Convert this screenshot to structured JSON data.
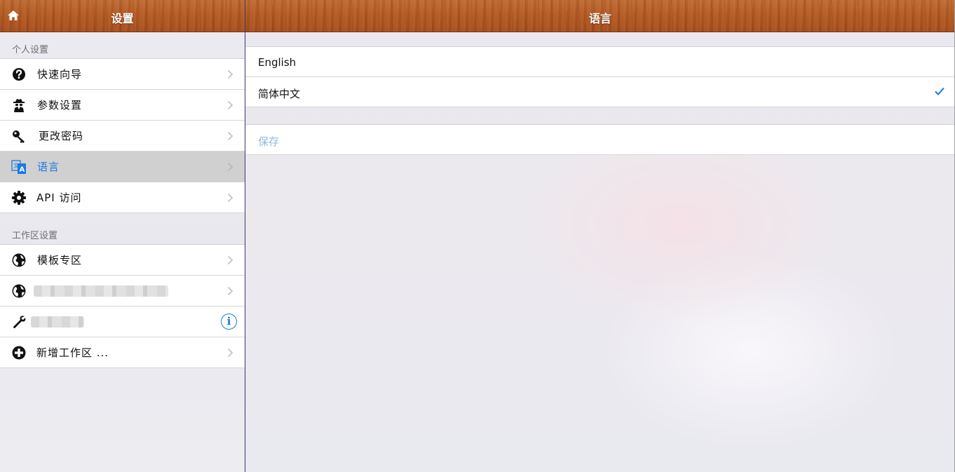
{
  "sidebar": {
    "title": "设置",
    "sections": [
      {
        "header": "个人设置",
        "items": [
          {
            "label": "快速向导",
            "icon": "question-circle-icon"
          },
          {
            "label": "参数设置",
            "icon": "spy-icon"
          },
          {
            "label": "更改密码",
            "icon": "key-icon"
          },
          {
            "label": "语言",
            "icon": "translate-icon",
            "selected": true
          },
          {
            "label": "API 访问",
            "icon": "gear-icon"
          }
        ]
      },
      {
        "header": "工作区设置",
        "items": [
          {
            "label": "模板专区",
            "icon": "globe-icon"
          },
          {
            "label": "",
            "icon": "globe-icon",
            "redacted": true
          },
          {
            "label": "",
            "icon": "wrench-icon",
            "redacted": true,
            "accessory": "info-icon"
          },
          {
            "label": "新增工作区 ...",
            "icon": "plus-circle-icon"
          }
        ]
      }
    ]
  },
  "main": {
    "title": "语言",
    "languages": [
      {
        "label": "English",
        "checked": false
      },
      {
        "label": "简体中文",
        "checked": true
      }
    ],
    "save_label": "保存"
  },
  "colors": {
    "accent": "#1a7ae0",
    "save_disabled": "#8fb8e3",
    "selected_row": "#d0d0d0",
    "header_wood": "#b45a22"
  }
}
